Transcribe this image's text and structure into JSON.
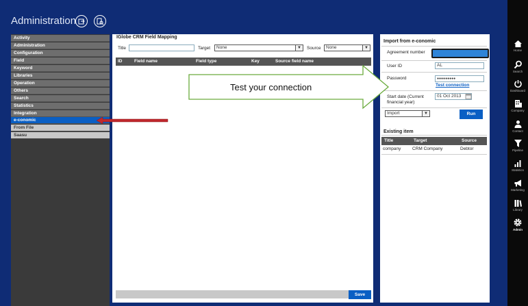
{
  "header": {
    "title": "Administration"
  },
  "sidebar": {
    "items": [
      {
        "label": "Activity"
      },
      {
        "label": "Administration"
      },
      {
        "label": "Configuration"
      },
      {
        "label": "Field"
      },
      {
        "label": "Keyword"
      },
      {
        "label": "Libraries"
      },
      {
        "label": "Operation"
      },
      {
        "label": "Others"
      },
      {
        "label": "Search"
      },
      {
        "label": "Statistics"
      },
      {
        "label": "Integration"
      },
      {
        "label": "e-conomic"
      },
      {
        "label": "From File"
      },
      {
        "label": "Saasu"
      }
    ]
  },
  "mapping": {
    "title": "IGlobe CRM Field Mapping",
    "title_label": "Title",
    "title_value": "",
    "target_label": "Target",
    "target_value": "None",
    "source_label": "Source",
    "source_value": "None",
    "columns": [
      "ID",
      "Field name",
      "Field type",
      "Key",
      "Source field name"
    ],
    "save_label": "Save"
  },
  "callout": {
    "text": "Test your connection"
  },
  "import": {
    "title": "Import from e-conomic",
    "agreement_label": "Agreement number",
    "agreement_value": "",
    "userid_label": "User ID",
    "userid_value": "AL",
    "password_label": "Password",
    "password_value": "●●●●●●●●●",
    "test_connection": "Test connection",
    "startdate_label": "Start date (Current financial year)",
    "startdate_value": "01 Oct 2013",
    "action_value": "Import",
    "run_label": "Run"
  },
  "existing": {
    "title": "Existing item",
    "columns": [
      "Title",
      "Target",
      "Source"
    ],
    "rows": [
      [
        "company",
        "CRM Company",
        "Debtor"
      ]
    ]
  },
  "nav": {
    "items": [
      {
        "label": "Home",
        "icon": "home-icon"
      },
      {
        "label": "Search",
        "icon": "search-icon"
      },
      {
        "label": "Dashboard",
        "icon": "power-icon"
      },
      {
        "label": "Company",
        "icon": "building-icon"
      },
      {
        "label": "Contact",
        "icon": "person-icon"
      },
      {
        "label": "Pipeline",
        "icon": "funnel-icon"
      },
      {
        "label": "Statistics",
        "icon": "chart-icon"
      },
      {
        "label": "Marketing",
        "icon": "megaphone-icon"
      },
      {
        "label": "Library",
        "icon": "books-icon"
      },
      {
        "label": "Admin",
        "icon": "gear-icon"
      }
    ]
  },
  "colors": {
    "header_bg": "#0f2c75",
    "active_item": "#0a5fc4",
    "callout_border": "#6aab3c",
    "arrow_red": "#c0282d"
  }
}
